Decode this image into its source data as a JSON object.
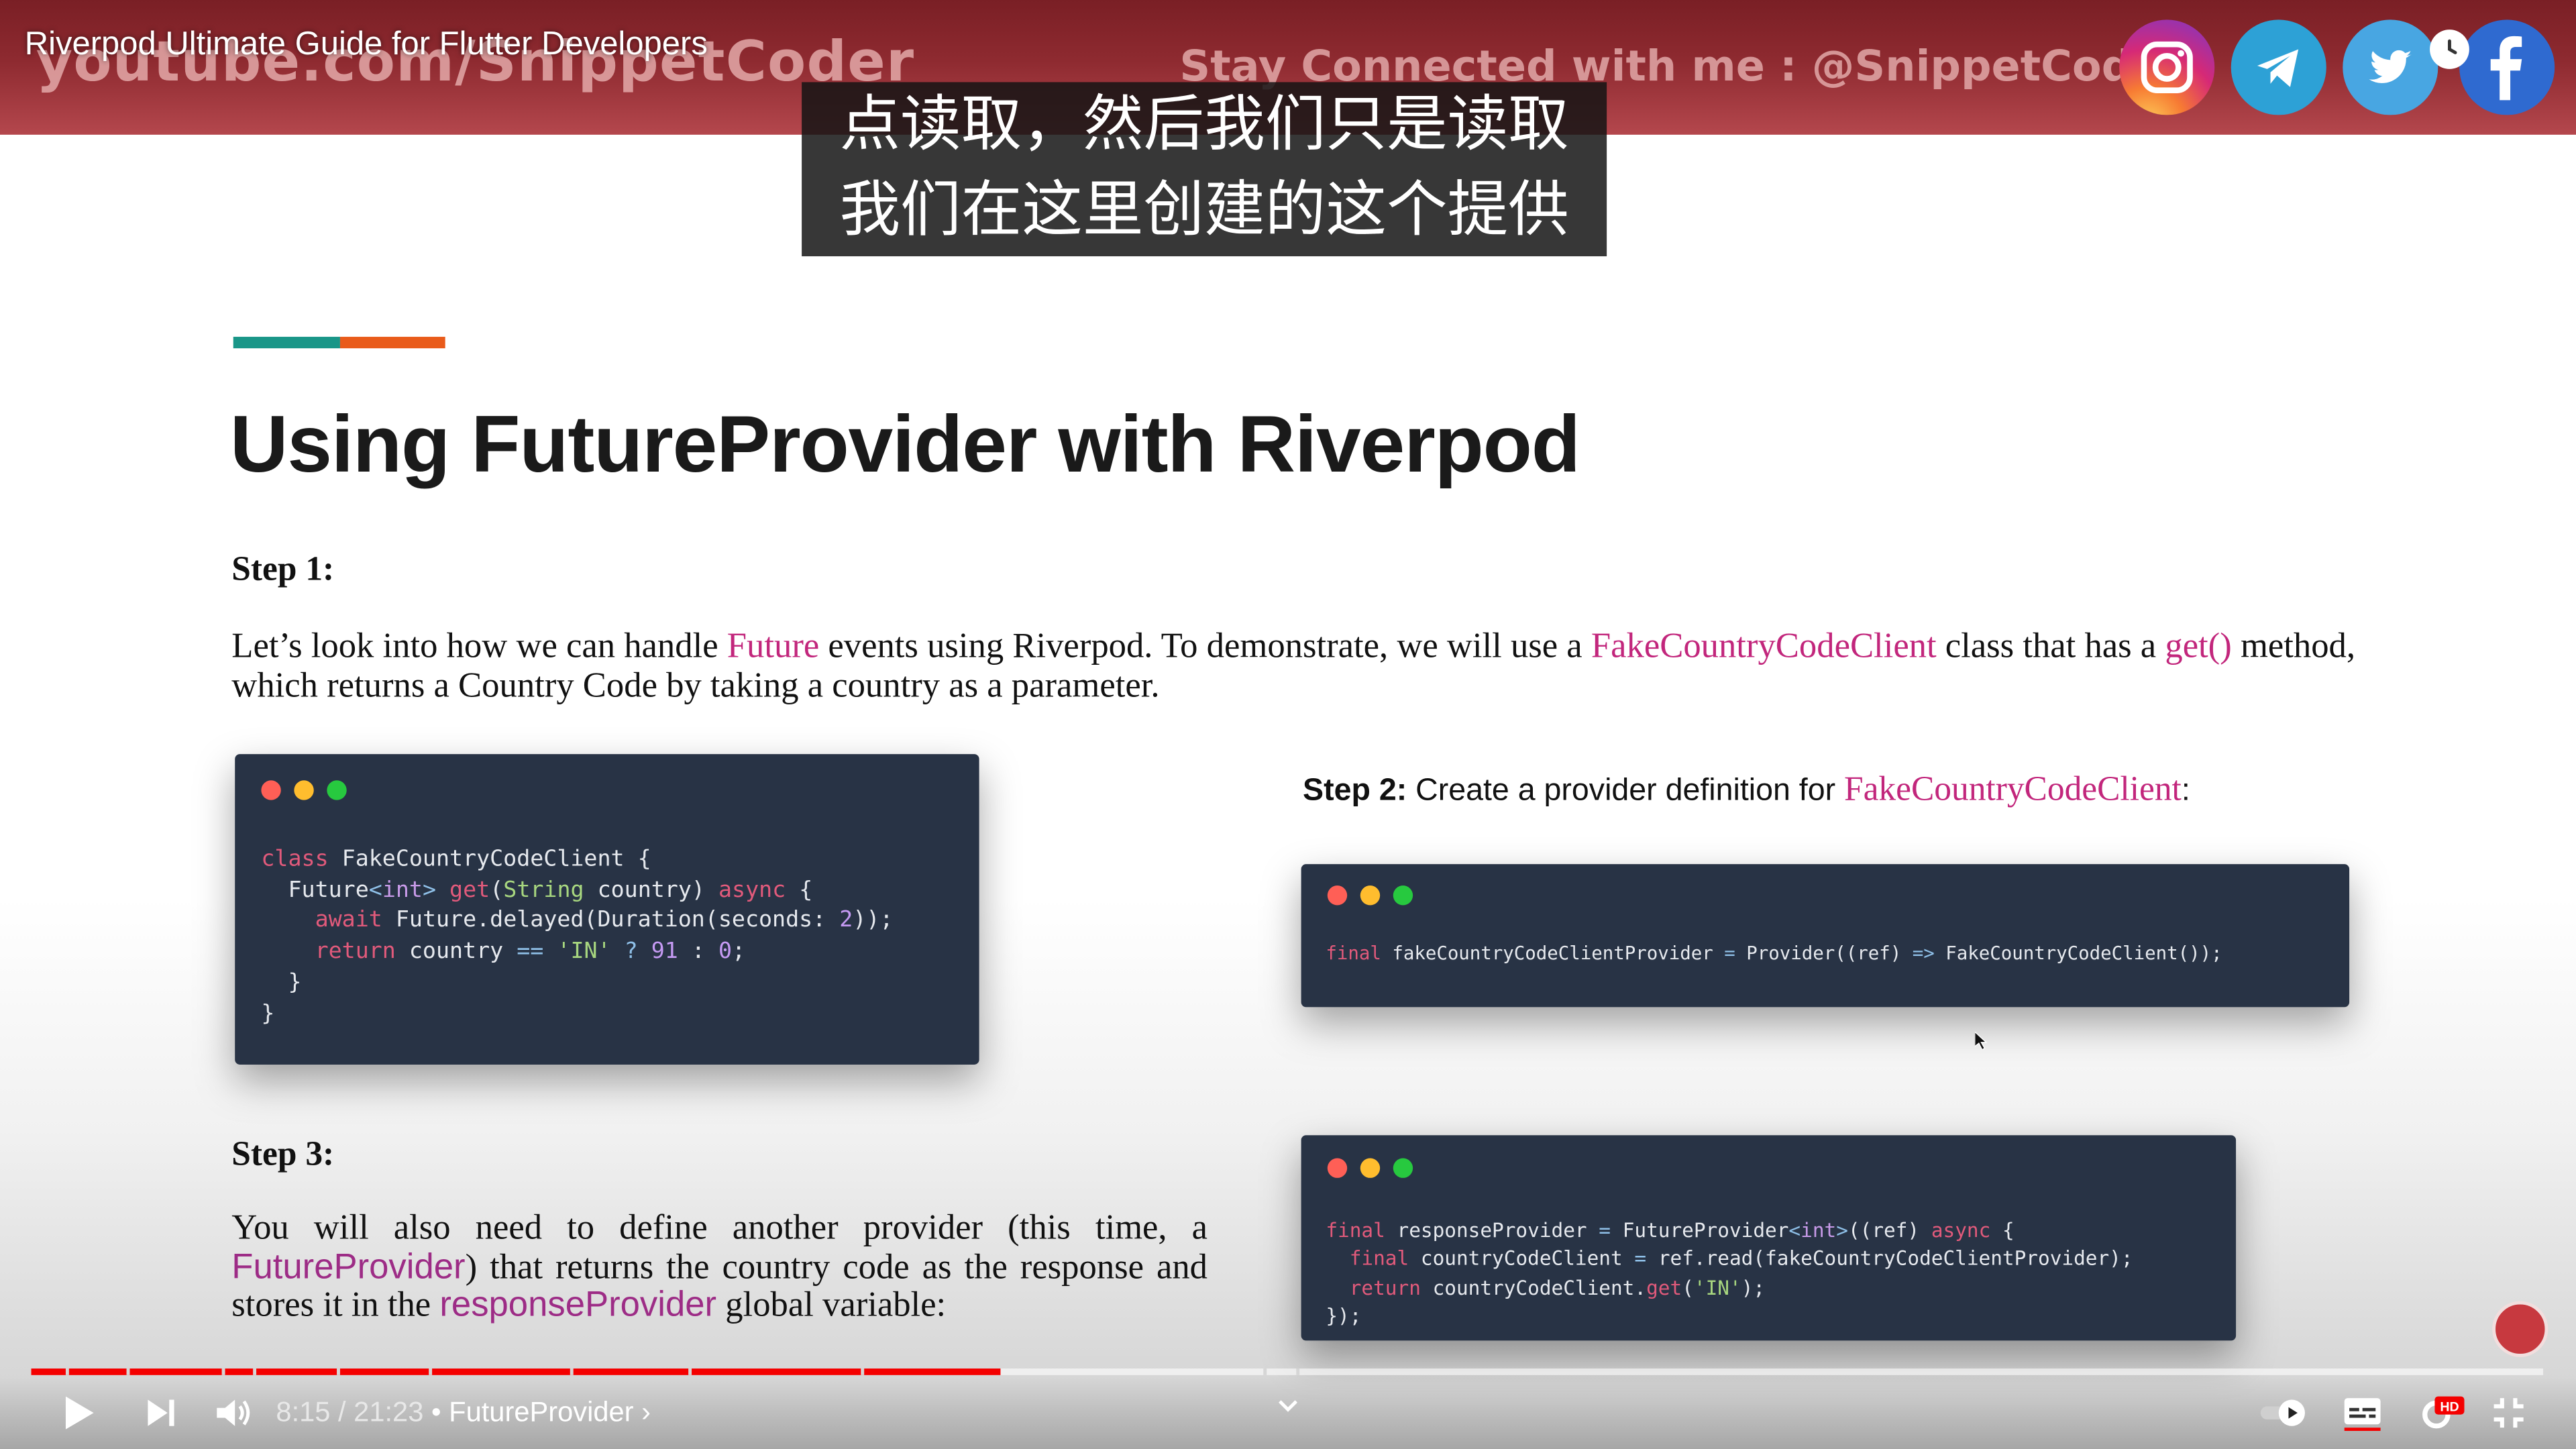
{
  "player": {
    "video_title": "Riverpod Ultimate Guide for Flutter Developers",
    "time_display": "8:15 / 21:23",
    "separator": "•",
    "chapter": "FutureProvider",
    "chapter_chevron": "›",
    "progress": 0.386
  },
  "banner": {
    "channel_url": "youtube.com/SnippetCoder",
    "connect_text": "Stay Connected with me : @SnippetCoder",
    "social_icons": [
      "instagram-icon",
      "telegram-icon",
      "twitter-icon",
      "facebook-icon"
    ]
  },
  "subtitles": {
    "line1": "点读取，然后我们只是读取",
    "line2": "我们在这里创建的这个提供"
  },
  "slide": {
    "title": "Using FutureProvider with Riverpod",
    "step1_heading": "Step 1:",
    "step1_text_a": "Let’s look into how we can handle ",
    "step1_hl1": "Future",
    "step1_text_b": " events using Riverpod. To demonstrate, we will use a ",
    "step1_hl2": "FakeCountryCodeClient",
    "step1_text_c": " class that has a ",
    "step1_hl3": "get()",
    "step1_text_d": " method, which returns a Country Code by taking a country as a parameter.",
    "step2_label": "Step 2:",
    "step2_text": " Create a provider definition for ",
    "step2_hl": "FakeCountryCodeClient",
    "step2_colon": ":",
    "step3_heading": "Step 3:",
    "step3_text_a": "You will also need to define another provider (this time, a ",
    "step3_hl1": "FutureProvider",
    "step3_text_b": ") that returns the country code as the response and stores it in the ",
    "step3_hl2": "responseProvider",
    "step3_text_c": " global variable:"
  },
  "code1": {
    "l1a": "class",
    "l1b": " FakeCountryCodeClient {",
    "l2a": "  Future",
    "l2b": "<",
    "l2c": "int",
    "l2d": ">",
    "l2e": " get",
    "l2f": "(",
    "l2g": "String",
    "l2h": " country) ",
    "l2i": "async",
    "l2j": " {",
    "l3a": "    await",
    "l3b": " Future.delayed(Duration(seconds: ",
    "l3c": "2",
    "l3d": "));",
    "l4a": "    return",
    "l4b": " country ",
    "l4c": "==",
    "l4d": " ",
    "l4e": "'IN'",
    "l4f": " ",
    "l4g": "?",
    "l4h": " ",
    "l4i": "91",
    "l4j": " : ",
    "l4k": "0",
    "l4l": ";",
    "l5": "  }",
    "l6": "}"
  },
  "code2": {
    "a": "final",
    "b": " fakeCountryCodeClientProvider ",
    "c": "=",
    "d": " Provider((ref) ",
    "e": "=>",
    "f": " FakeCountryCodeClient());"
  },
  "code3": {
    "l1a": "final",
    "l1b": " responseProvider ",
    "l1c": "=",
    "l1d": " FutureProvider",
    "l1e": "<",
    "l1f": "int",
    "l1g": ">",
    "l1h": "((ref) ",
    "l1i": "async",
    "l1j": " {",
    "l2a": "  final",
    "l2b": " countryCodeClient ",
    "l2c": "=",
    "l2d": " ref.read(fakeCountryCodeClientProvider);",
    "l3a": "  return",
    "l3b": " countryCodeClient.",
    "l3c": "get",
    "l3d": "(",
    "l3e": "'IN'",
    "l3f": ");",
    "l4": "});"
  },
  "colors": {
    "banner": "#8e2a30",
    "accent_teal": "#199688",
    "accent_orange": "#e95b1a",
    "highlight": "#c2267c",
    "code_bg": "#283345",
    "progress": "#f40000"
  }
}
